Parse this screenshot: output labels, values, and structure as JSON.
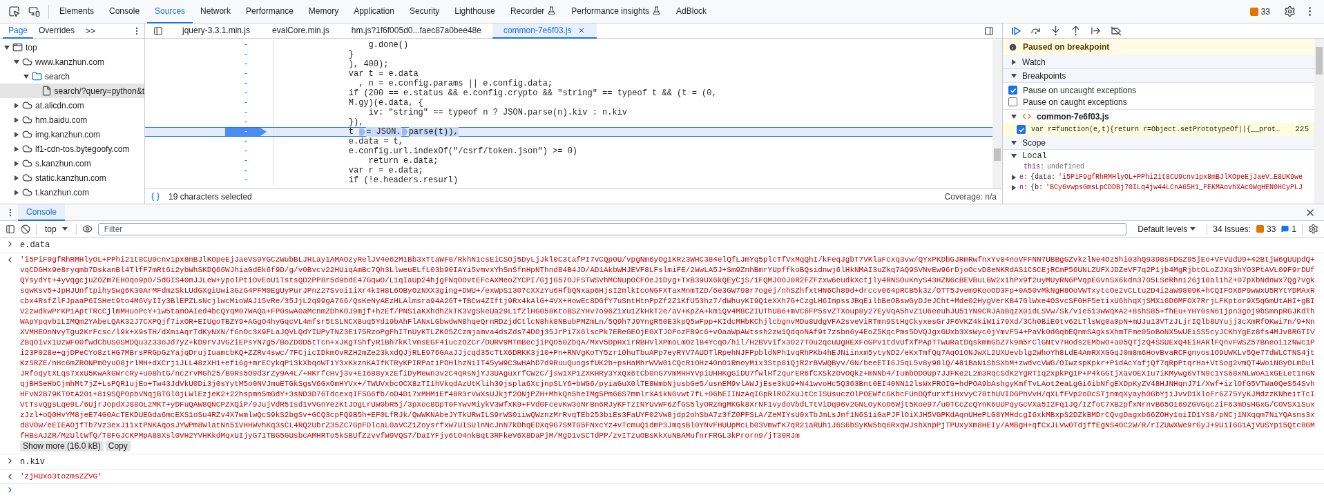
{
  "main_tabs": [
    {
      "label": "Elements",
      "selected": false,
      "experimental": false
    },
    {
      "label": "Console",
      "selected": false,
      "experimental": false
    },
    {
      "label": "Sources",
      "selected": true,
      "experimental": false
    },
    {
      "label": "Network",
      "selected": false,
      "experimental": false
    },
    {
      "label": "Performance",
      "selected": false,
      "experimental": false
    },
    {
      "label": "Memory",
      "selected": false,
      "experimental": false
    },
    {
      "label": "Application",
      "selected": false,
      "experimental": false
    },
    {
      "label": "Security",
      "selected": false,
      "experimental": false
    },
    {
      "label": "Lighthouse",
      "selected": false,
      "experimental": false
    },
    {
      "label": "Recorder",
      "selected": false,
      "experimental": true
    },
    {
      "label": "Performance insights",
      "selected": false,
      "experimental": true
    },
    {
      "label": "AdBlock",
      "selected": false,
      "experimental": false
    }
  ],
  "issues_count": "33",
  "navigator": {
    "tabs": [
      {
        "label": "Page",
        "selected": true
      },
      {
        "label": "Overrides",
        "selected": false
      }
    ],
    "more": ">>",
    "tree": [
      {
        "label": "top",
        "kind": "frame",
        "expanded": true,
        "selected": false,
        "children": [
          {
            "label": "www.kanzhun.com",
            "kind": "domain",
            "expanded": true,
            "selected": false,
            "children": [
              {
                "label": "search",
                "kind": "folder",
                "expanded": true,
                "selected": false,
                "children": [
                  {
                    "label": "search/?query=python&t",
                    "kind": "file",
                    "selected": true
                  }
                ]
              }
            ]
          },
          {
            "label": "at.alicdn.com",
            "kind": "domain",
            "expanded": false,
            "selected": false
          },
          {
            "label": "hm.baidu.com",
            "kind": "domain",
            "expanded": false,
            "selected": false
          },
          {
            "label": "img.kanzhun.com",
            "kind": "domain",
            "expanded": false,
            "selected": false
          },
          {
            "label": "lf1-cdn-tos.bytegoofy.com",
            "kind": "domain",
            "expanded": false,
            "selected": false
          },
          {
            "label": "s.kanzhun.com",
            "kind": "domain",
            "expanded": false,
            "selected": false
          },
          {
            "label": "static.kanzhun.com",
            "kind": "domain",
            "expanded": false,
            "selected": false
          },
          {
            "label": "t.kanzhun.com",
            "kind": "domain",
            "expanded": false,
            "selected": false
          }
        ]
      }
    ]
  },
  "editor": {
    "tabs": [
      {
        "label": "jquery-3.3.1.min.js",
        "selected": false
      },
      {
        "label": "evalCore.min.js",
        "selected": false
      },
      {
        "label": "hm.js?1f6f005d0...faec87a0bee48e",
        "selected": false
      },
      {
        "label": "common-7e6f03.js",
        "selected": true
      }
    ],
    "lines": [
      {
        "marker": "-",
        "paused": false,
        "code": "        g.done()"
      },
      {
        "marker": "-",
        "paused": false,
        "code": "    }"
      },
      {
        "marker": "-",
        "paused": false,
        "code": "    ), 400);"
      },
      {
        "marker": "-",
        "paused": false,
        "code": "    var t = e.data"
      },
      {
        "marker": "-",
        "paused": false,
        "code": "      , n = e.config.params || e.config.data;"
      },
      {
        "marker": "-",
        "paused": false,
        "code": "    if (200 == e.status && e.config.crypto && \"string\" == typeof t && (t = (0,"
      },
      {
        "marker": "-",
        "paused": false,
        "code": "    M.gy)(e.data, {"
      },
      {
        "marker": "-",
        "paused": false,
        "code": "        iv: \"string\" == typeof n ? JSON.parse(n).kiv : n.kiv"
      },
      {
        "marker": "-",
        "paused": false,
        "code": "    }),"
      },
      {
        "marker": "-",
        "paused": true,
        "parts": [
          "    t ",
          "= JSON.",
          "parse(t)),"
        ]
      },
      {
        "marker": "-",
        "paused": false,
        "code": "    e.data = t,"
      },
      {
        "marker": "-",
        "paused": false,
        "code": "    e.config.url.indexOf(\"/csrf/token.json\") >= 0)"
      },
      {
        "marker": "-",
        "paused": false,
        "code": "        return e.data;"
      },
      {
        "marker": "-",
        "paused": false,
        "code": "    var r = e.data;"
      },
      {
        "marker": "-",
        "paused": false,
        "code": "    if (!e.headers.resurl)"
      }
    ],
    "status": "19 characters selected",
    "coverage": "Coverage: n/a"
  },
  "debugger": {
    "banner": "Paused on breakpoint",
    "watch": {
      "label": "Watch",
      "expanded": false
    },
    "breakpoints": {
      "label": "Breakpoints",
      "expanded": true,
      "options": [
        {
          "label": "Pause on uncaught exceptions",
          "checked": true
        },
        {
          "label": "Pause on caught exceptions",
          "checked": false
        }
      ],
      "files": [
        {
          "name": "common-7e6f03.js",
          "expanded": true,
          "entries": [
            {
              "code": "var r=function(e,t){return r=Object.setPrototypeOf||{__prot…",
              "line": "225",
              "checked": true
            }
          ]
        }
      ]
    },
    "scope": {
      "label": "Scope",
      "expanded": true,
      "groups": [
        {
          "label": "Local",
          "expanded": true,
          "items": [
            {
              "name": "this:",
              "kind": "primitive",
              "value": "undefined"
            },
            {
              "name": "e:",
              "kind": "object",
              "expanded": false,
              "prefix": "{data:",
              "value": "'i5PiF9gfRhRMHlyOL+PPhi21t8CU9cnv1px8mBJlKOpeEjJaeV…E8UK9we"
            },
            {
              "name": "n:",
              "kind": "object",
              "expanded": false,
              "prefix": "{b:",
              "value": "'BCy6vwpsGmsLpCDDBj70ILq4jw44LCnA65H1_FEKMAovhXAc0WgHEN0HCyPLJ"
            }
          ]
        }
      ]
    }
  },
  "console": {
    "tab": {
      "label": "Console",
      "selected": true
    },
    "context": "top",
    "filter_placeholder": "Filter",
    "levels": "Default levels",
    "issues_label": "34 Issues:",
    "issues_warnings": "33",
    "issues_info": "1",
    "entries": [
      {
        "kind": "input",
        "text": "e.data"
      },
      {
        "kind": "output",
        "text": "'i5PiF9gfRhRMHlyOL+PPhi21t8CU9cnv1px8mBJlKOpeEjJaeVS9YGCzWubBLJHLay1AMAOzyRelJV4e62M1Bb3xTtaWF8/RkhN1csEiCSOj5DyLjJkl0C3tafPI7vCQp0U/vpgNm6yOg1KRz3WHC384elQfLJmYq5plcTfVxMqQhI/kFeqJgbT7VKlaFcxq3vw/QYxPKDbGJRmRwfnxYv04noVFFNN7UBBgGZvkzlNe4Oz5hi03hQ9398sFDGZ95jEo+VFVUdU9+42BtjW6gUUpdQ+vqCDGHx9e8ryqmb7DskanBl4TlfF7mRt6i2ybWhSKDQ66WJhiaGdEk6f9D/g/v0Bvcv22HUiqAmBc7Qh3LlweuELfL03b90IAYi5vmvxYhSnSfnHpNThnd84B4JD/AD1AkbWHJEVF8LFslmiFE/2WwLA5J+Sm9ZnhBmrYUpffkoBQsidnwj6lHkNMAI3uZkq7AQ9SVNvEw96rDjoOcvD8eNKRdAS1CSCEjRCmP56UNLZUFXJDZeVF7q2P1jb4MgRjbtOLoZJXq3hYO3PtAVL09F9rDUfQYsydYt+4yvqgcjuZOZm7EHOqo9pO/5dGIS40mJJLeW+ypolPtiOvEoUiTstsQD2PP8r5d9bdE47GqwO/L1qIaUp24hjgFNqOOvtEFcAXMeoZYCPI/GjjG57OJFSTWSVhMCNupOCFOeJ1Dyg+TxB39UX6kQEyCjS/1FQMJOOJ0R2FZFzxw6eudkXctjly4RNSOuKnyS43HZN6cBEVBuLBW2xihPx9f2uyMUyRN6PVqpEGvnSX6kdn3705LSeRhni26j18al1hZ+07pXbNdnWx7Qg7vgksqwKsv5+JpHJUnftpihySwg6K38ArMFdmzSkLUdGXgiUwi3GzG4PFM0EgUyPurJPnz27Svoi1iXr4kIH8L6OByOzNXX3ging+DWU+/exWpS1307cXXzYu6HfbQNxap6HjsI2mlkIcoNGFXTaxMnmTZD/6e3GW798r7ogej/nhSZhfxtHN6Ch89d+drccv064pRCB5k3z/OTT5Jvem9KooOD3Fp+0A50vMkNgH8OoVWTxytcOe2vCLtu2D4i2aW9809K+hCQIFOX6P9wWxU5RYtYDMAxRcbx4RsfZlFJpaaP6ISHet9to4M6VyIIy3BlEPZLsNcjlwcMioWAJ15vRe/35JjL2q99gA766/QsKeNyAEzHLAlmsra94A26T+TBCw4ZIftj9Rx4kAlG+4VX+HowEc8DGfY7uSntHtnPpZf2Z1KfU53hz7/dWhuyKI9Q1eXXh7G+CzgLH6ImpssJBqEilbBeOBswGyDJeJCht+Mde02HygVerKB47GlWxe4OSvcSF0HF5etixU6hhqXjSMXi6D0MFOX7RrjLFKptor9X5qGmUtAHI+gBIV2zwdkwPrKP1AptTRcCjlmMHuoPcY+1w5tamOAIed4bcQYqM07WAQa+FP0swA0aMcnmZDhKOJ9mjf+hzEf/PNSiaKXhdhZkTK3VgSkeUa29L1fZlHG058KtoBSZYHv7o96Z1xu1ZkHkT2e/aV+KpZA+kmiQv4M8CZIUThUB6+mVC6FP5svZTXoup8y27EyVqA5hvZ1U6eeuhJU51YN9CRJAaBqzX0idLSVw/Sk/vie513wWqKA2+8shS85+fhEu+YHY0sN61jpn3goj9bSmnpRGJKdThWApYpqvb1LIMQm2YAbeLQAK32J7CXPQjf7ixOR+EIUgoTBZY9+AGgO4hyGqcVL4mfsr5tSLNCX8uq5Yd19bAhFlANxLGbwdwN8hqeQrnRDzjdCtlcN8hk8NBubPMZmLn/5Q9h7J9YngR50E3kpQ5wFpp+KIdcMHbKChjlcbgnvMDu8UdgVFA2sveViRTmn9StHgCkyxesGrJF6VKZ4kiW1i79Xd/3Ch0BiE0tv62LTlsWg0a0pN+mUJu13VTzJLjrIQlb8UYujj3cXmRfOKwi7n/9+NnXVMHEOnNvyTgu2KrFcsc/l9k+X9sTH/dXmiAqrTdKyNXN/f6nOc3X9FLaJQVLQdYIUPyTNZ3E175RzoPgFhITnUyKTLZKO5ZCzmjamva4dsZds74DOj35JrPi7X6lscPk7EReGEOjEGXTJOFozFB9c6+vOaaWpAWtssh2zw1QdqoNAf9t7zsbn6y4EoZ5KqcPms5DVQJgxGUxb3XsWyc0jYmvF54+PaVk0dGqbEQnmSAgksXhmTFme05oBoNX5wUEiSS5cyJCKhYgEz8fs4MJv8RGTIVZBqOivx1UzWF00fwdCbUS0SMDQu3z33oJd7yZ+kD9rVJVGZiEPsYN7g5/BoZDOD5tTcn+xJKgTShfyRiBh7kKlVmsEGF4iuczOZCr/DURV9MTmBecjiPQO50ZbqA/MxV5DpHx1rRBHVlXPmoLmOzlB4YcqO/hil/H2BVvifx3O27T0u2qcuUgHEXFoGPv1tdvUfXfPApTTwuRatDqskmmGbZ7k9m5rClGNtv7Hods2EMbwO+a05QTjzQ4SSUExQ4EiHARlFQnvFWSZ57Bneoi1zNwc1Pi23P028e+gjDPeCYo8ztHG7MBrsPRGpGzYajqDrujIuamcbKQ+ZZRv4swc/7FCjicIDkmOvRZH2mZe23kxdQJjRLE976GAaJJjcqd35cTtX6DRKK3j10+Pn+RNVgKoTY5zr10huTbuAPp7eyRYV7AUDTlRpehNJFPpbldNPh1vqRhPKb4hEJNiinxm5ytyND2/eKxTmfQq7AqO1ONJwXL2UXUevblg2WhoYh8LdE4AmRXXGGqJ0m8m6HovBvaRCFgnyos1O9UWKLv5Qe77dWLCTNS4jtKzSRZE/nHc6mZRONPmOyuO8jrlMH+dXCrjiJLL48zXH1+efi6g+mrECykqP13kXbqoWTiY3xKkznKAIfKTRyKPIRPatiPDHlhzNiIT45yW9C3wHAhD7d9RuuQuogsfUK2b+psHaMhrWVW0iCQcRiOHz40nO1RmoyMix3Stp8iQjR2rBVWQByv/GN/beeETI6J5qL5v8y98lQ/481BaNiSbSXbM+zwdvcVWG/OIwzspKpkr+P1dAcYafjQf7qRpPtqrHa+VtSog2vmQT4WoiNGyOLmDulJRfoqytXLqs7xxU5KwAkGWrcRy+u08htG/nczrvMGh25/B9Rs5O9d3rZy9A4L/+HKrfcHvj3v+EI688yxzEfiDyMewn3v2C4qRsNjYJ3UAguxrfCWzC/jsw1XP1ZXKHRy3YxQx6tCb0nG7VmMHHYVpiUHHKgGiDU7fwlHf2qurER6fCXSkzOvOQkz+mNNb4/IumbOD0Up7JJFKe2L2m3RqcSdK2YgRTIq2xpkPg1P+P4kGGtjXavOEXIu7iKMywg6vTN9c1YS68xNLWoA1xGELet1nGNqjBHSeHbCjmhMt7jZ+LsPQR1ujEo+Tw43JdVkU0Di3j0sYytM5o0NVJmuETGkSgsV6GxOmHYVx+/TWUVxbcOCX8zTI1hVkqdAzUtKlih39jspla6XcjnpSLY6+bWG6/pyiaGuX0lTE8WmbNjusbGe5/usnEM9vlAWJjEse3kU9+N41wvoHc5Q363Bnt0EI40NN12lsWxFROIG+hdPOA9bAshgyKmfTvLAot2eaLgGi6ibNfgEXDpKyZV48HJNHqnJ71/Xwf+izlOfG5VTWa0QeS54SvhHFvN2B79KT0tA20i+8i9SQPOpbVNqjBTGl0jLWlEzjeK2+22hspmn5mGdY+3sND3D76TdcexqIF5G6fb/oD4Di7xMHMiEf48R3rVwXsUJkjf2ONjPZH+MhkQn5heIMg5Pm66S7mmlrXA1kNGvwt7fL+06hEIINzAqIGpRlROZXUJtCcISUsuczOlPOEWfcGKbcFUnDQfurxfiHxvyC78thUVIDGPhVvH/qXLfFVp2oDcSTjnmqXyayh0GbYjiJvvD1XloFr6Z75YyKJMdzzKNheitTcIVtTsvQgsLqe9L/6UjrJopdXJ88OL2MKT+yDFuQAW8QNCPZXQiP/9JujVdR5Isd1vVGnYezKtJDgLrUW0bR5j/3pXoc8DpT0FYwvMiykV3WfxK9+FVd0FcevKw3oNrBn6RJyKFTzINYUvWF6ZfGS5lyORzmgMKGk8XrNF1vydoVbdLTtViDq96v2GNLOyKoO6Wjt5Koe97/u0TCcZcQYnK6UUPqyGcVXa5I2Fq1JQ/IZfoC7XB2pfxNrnvB65O169ZGVGqcziF63mDsHGxG/COVSX1SuxzJzl+oQ0HvYM8jeE74G0AcTEKDUEGda6mcEXS1oSu4RZv4X7wmlwQcS9kS2bgSv+GCQ3cpFQ9B5h+EF0LfRJk/QwWKNAbeJYTkURwILS9rWS0iiwQWznzMrRvqTEb253biEs3FaUYF02Vw8jdp2ohSbA7z3fZ0PFSLA/ZeMIYsU0xTbJmLsJmf1N6S1iGaPJFlOiXJH5VGPKdAqnUHePLG8YMHdcgI6xkMBxpS2DZkBMDrCQvgDagxb66ZOHy1oiID1YS8/pNCj1NXqqm7NiYQAsns3xd8VOw/eEIEAOjfTb7Vz3exJ11xtPNKAqosJYWPm8WlatNn51VHHWvhKq3sCL4RQ2UbrZ35ZC7GpFDlcaL0aVCZ1Zoysrfxw7UISUlnNcJnN7kDhqEDXq9G7SMTG5FNxcYz4vTcmuQ1dmP3JmqsBl0YNvFHUUpMcLb03VmwfK7qR21aRUh1J6S6bSyKW5bq6RxqWJshXnpPjTPUxyXm8HEIy/AMBgH+qfCxJLVw0TdjffEgNS4OC2W/R/rIZUWXWe9rGyJ+9UiI6G1AjVUSYp15Qtc8GMfHBsAJZR/MzUltWfQ/T8FGJCKPMpA88Xsl0VH2YVHKkdMqxUIjyG71TBG5GUsbcAMHRTo5kSBUfZzvvfW9VQS7/DaIYFjy6tO4nkBqt3RFkeV6X8DaPjM/MgD1vSCTdPP/zvITzuOBsKkXuNBAMufnrFRGL3kProrn9/jT30RJm",
        "show_more": "Show more (16.0 kB)",
        "copy": "Copy"
      },
      {
        "kind": "input",
        "text": "n.kiv"
      },
      {
        "kind": "output",
        "text": "'zjHUxo3tozmsZZVG'"
      },
      {
        "kind": "prompt"
      }
    ]
  }
}
